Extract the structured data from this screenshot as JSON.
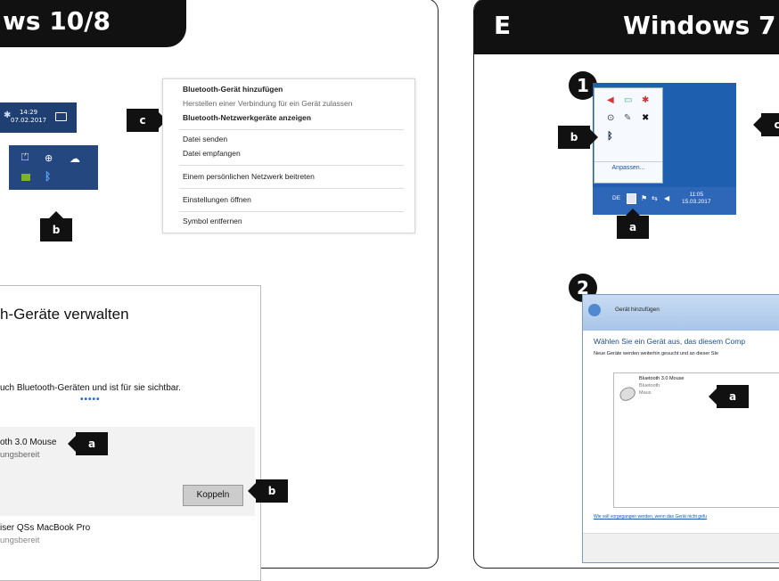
{
  "left_panel": {
    "title": "ws 10/8",
    "taskbar": {
      "time": "14:29",
      "date": "07.02.2017"
    },
    "context_menu": {
      "items": [
        "Bluetooth-Gerät hinzufügen",
        "Herstellen einer Verbindung für ein Gerät zulassen",
        "Bluetooth-Netzwerkgeräte anzeigen",
        "Datei senden",
        "Datei empfangen",
        "Einem persönlichen Netzwerk beitreten",
        "Einstellungen öffnen",
        "Symbol entfernen"
      ]
    },
    "settings": {
      "heading": "h-Geräte verwalten",
      "info": "uch Bluetooth-Geräten und ist für sie sichtbar.",
      "device1_name": "oth 3.0 Mouse",
      "device1_status": "ungsbereit",
      "pair_button": "Koppeln",
      "device2_name": "iser QSs MacBook Pro",
      "device2_status": "ungsbereit"
    },
    "callouts": {
      "c": "c",
      "b_tray": "b",
      "a_device": "a",
      "b_pair": "b"
    }
  },
  "right_panel": {
    "letter": "E",
    "title": "Windows 7",
    "step1": "1",
    "step2": "2",
    "popup_link": "Anpassen...",
    "taskbar": {
      "lang": "DE",
      "time": "11:05",
      "date": "15.03.2017"
    },
    "wizard": {
      "titlebar": "Gerät hinzufügen",
      "heading": "Wählen Sie ein Gerät aus, das diesem Comp",
      "subtext": "Neue Geräte werden weiterhin gesucht und an dieser Ste",
      "device_name": "Bluetooth 3.0 Mouse",
      "device_type": "Bluetooth",
      "device_kind": "Maus",
      "help_link": "Wie soll vorgegangen werden, wenn das Gerät nicht gefu"
    },
    "callouts": {
      "b": "b",
      "a_taskbar": "a",
      "c": "c",
      "a_wizard": "a"
    }
  },
  "colors": {
    "win7_blue": "#1f5fb0",
    "win10_blue": "#1f3f73",
    "black": "#111111"
  }
}
